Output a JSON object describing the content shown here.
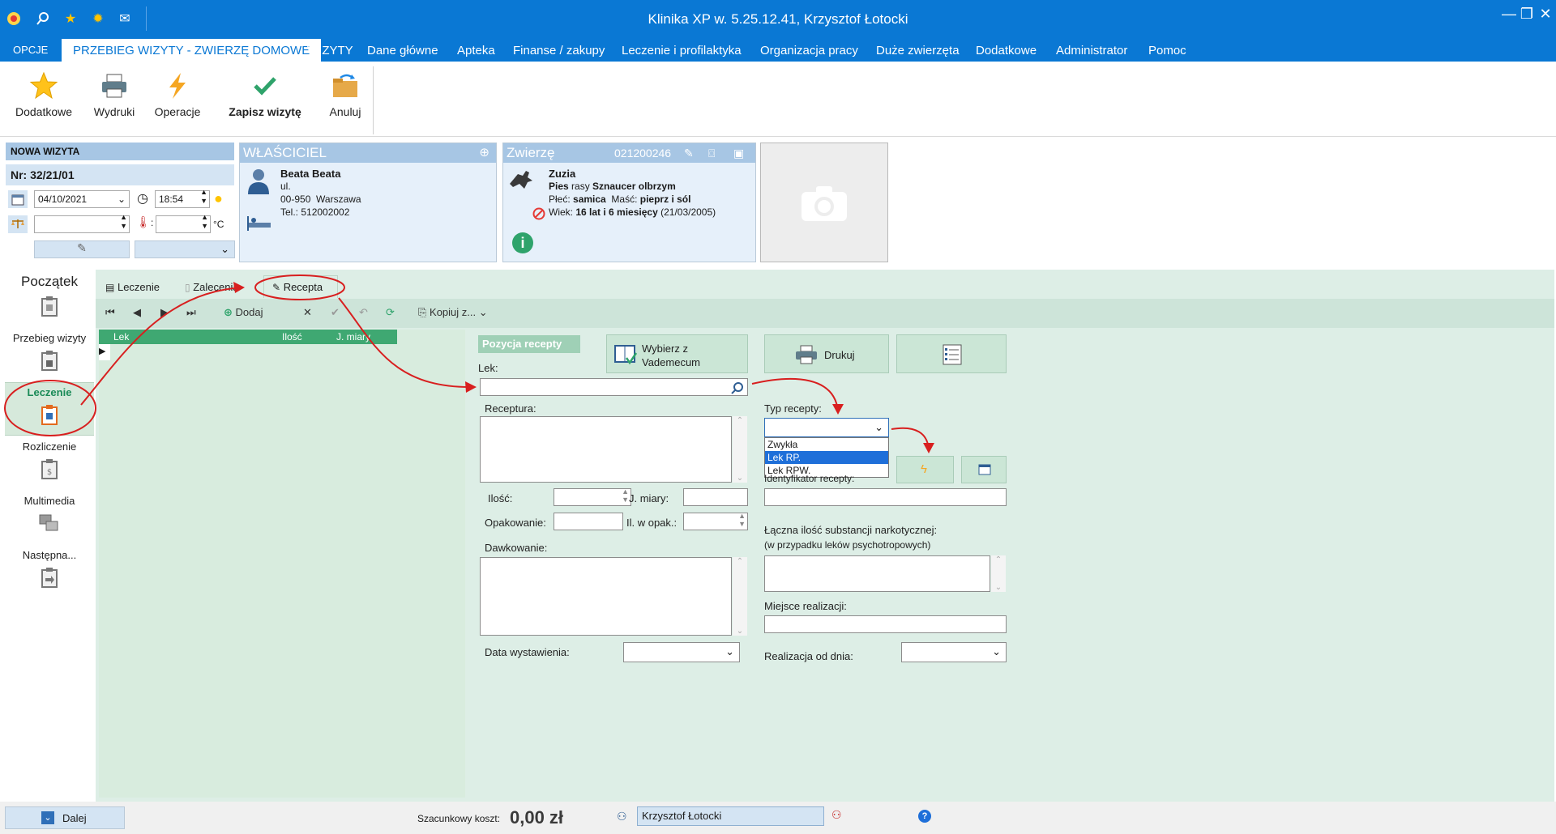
{
  "window": {
    "title": "Klinika XP w. 5.25.12.41, Krzysztof Łotocki",
    "controls": [
      "minimize-icon",
      "restore-icon",
      "close-icon"
    ]
  },
  "quick_access": [
    "app-logo-icon",
    "search-icon",
    "star-icon",
    "sun-icon",
    "mail-icon"
  ],
  "menu": {
    "opcje": "OPCJE",
    "active": "PRZEBIEG WIZYTY - ZWIERZĘ DOMOWE",
    "items": [
      "WIZYTY",
      "Dane główne",
      "Apteka",
      "Finanse / zakupy",
      "Leczenie i profilaktyka",
      "Organizacja pracy",
      "Duże zwierzęta",
      "Dodatkowe",
      "Administrator",
      "Pomoc"
    ]
  },
  "ribbon": {
    "dodatkowe": "Dodatkowe",
    "wydruki": "Wydruki",
    "operacje": "Operacje",
    "zapisz": "Zapisz wizytę",
    "anuluj": "Anuluj"
  },
  "visit": {
    "header": "NOWA WIZYTA",
    "number": "Nr: 32/21/01",
    "date": "04/10/2021",
    "time": "18:54",
    "temp_label": ":",
    "temp_unit": "°C"
  },
  "owner": {
    "header": "WŁAŚCICIEL",
    "name": "Beata Beata",
    "street": "ul.",
    "city": "00-950  Warszawa",
    "phone": "Tel.: 512002002"
  },
  "animal": {
    "header": "Zwierzę",
    "id": "021200246",
    "name": "Zuzia",
    "species_prefix": "Pies",
    "breed_label": "rasy",
    "breed": "Sznaucer olbrzym",
    "sex_label": "Płeć:",
    "sex": "samica",
    "color_label": "Maść:",
    "color": "pieprz i sól",
    "age_label": "Wiek:",
    "age": "16 lat i 6 miesięcy",
    "birth": "(21/03/2005)"
  },
  "nav": {
    "poczatek": "Początek",
    "przebieg": "Przebieg wizyty",
    "leczenie": "Leczenie",
    "rozliczenie": "Rozliczenie",
    "multimedia": "Multimedia",
    "nastepna": "Następna..."
  },
  "tabs": {
    "leczenie": "Leczenie",
    "zalecenia": "Zalecenia",
    "recepta": "Recepta"
  },
  "toolbar": {
    "dodaj": "Dodaj",
    "kopiuj": "Kopiuj z..."
  },
  "list": {
    "columns": [
      "Lek",
      "Ilość",
      "J. miary"
    ]
  },
  "recepta": {
    "pozycja": "Pozycja recepty",
    "wybierz_line1": "Wybierz z",
    "wybierz_line2": "Vademecum",
    "drukuj": "Drukuj",
    "lek_label": "Lek:",
    "lek_value": "",
    "receptura_label": "Receptura:",
    "ilosc_label": "Ilość:",
    "jmiary_label": "J. miary:",
    "opakowanie_label": "Opakowanie:",
    "il_w_opak_label": "Il. w opak.:",
    "dawkowanie_label": "Dawkowanie:",
    "data_wyst_label": "Data wystawienia:",
    "typ_label": "Typ recepty:",
    "typ_options": [
      "Zwykła",
      "Lek RP.",
      "Lek RPW."
    ],
    "typ_selected_index": 1,
    "identyfikator_label": "Identyfikator recepty:",
    "laczna_label": "Łączna ilość substancji narkotycznej:",
    "laczna_sub": "(w przypadku leków psychotropowych)",
    "miejsce_label": "Miejsce realizacji:",
    "realizacja_label": "Realizacja od dnia:"
  },
  "status": {
    "dalej": "Dalej",
    "koszt_label": "Szacunkowy koszt:",
    "koszt_value": "0,00 zł",
    "user": "Krzysztof Łotocki"
  },
  "colors": {
    "titlebar": "#0a78d4",
    "panel_header": "#a7c6e4",
    "main_bg": "#ddeee6",
    "list_header": "#3fa872",
    "annotation": "#d81f1f"
  }
}
